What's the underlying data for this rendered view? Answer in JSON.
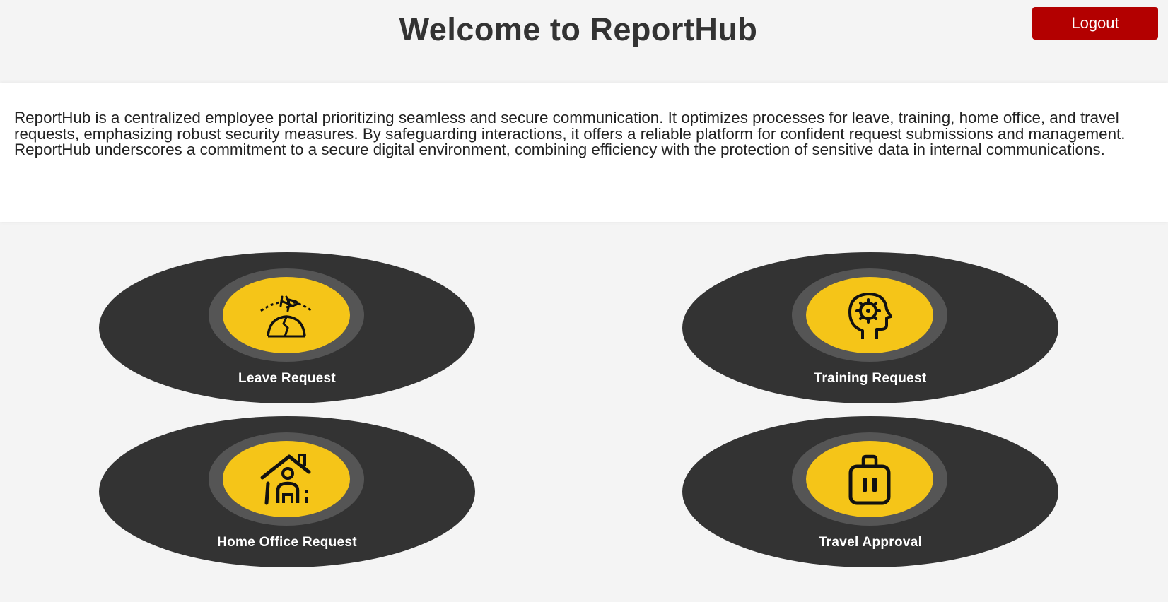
{
  "header": {
    "title": "Welcome to ReportHub",
    "logout_label": "Logout",
    "logout_color": "#b30000"
  },
  "intro": {
    "text": "ReportHub is a centralized employee portal prioritizing seamless and secure communication. It optimizes processes for leave, training, home office, and travel requests, emphasizing robust security measures. By safeguarding interactions, it offers a reliable platform for confident request submissions and management. ReportHub underscores a commitment to a secure digital environment, combining efficiency with the protection of sensitive data in internal communications."
  },
  "cards": [
    {
      "label": "Leave Request",
      "icon": "airplane-globe-icon"
    },
    {
      "label": "Training Request",
      "icon": "head-gear-icon"
    },
    {
      "label": "Home Office Request",
      "icon": "house-person-icon"
    },
    {
      "label": "Travel Approval",
      "icon": "suitcase-icon"
    }
  ],
  "colors": {
    "background": "#f4f4f4",
    "card": "#333333",
    "ring": "#555555",
    "accent": "#f5c518"
  }
}
